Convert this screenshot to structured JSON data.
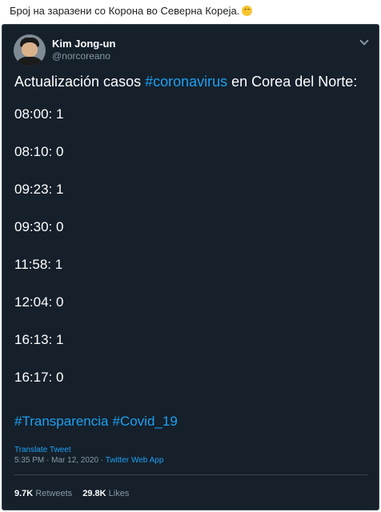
{
  "post": {
    "caption": "Број на заразени со Корона во Северна Кореја."
  },
  "tweet": {
    "user_name": "Kim Jong-un",
    "handle": "@norcoreano",
    "intro_before": "Actualización casos ",
    "intro_hashtag": "#coronavirus",
    "intro_after": " en Corea del Norte:",
    "entries": [
      "08:00: 1",
      "08:10: 0",
      "09:23: 1",
      "09:30: 0",
      "11:58: 1",
      "12:04: 0",
      "16:13: 1",
      "16:17: 0"
    ],
    "hashtags": [
      "#Transparencia",
      "#Covid_19"
    ],
    "translate_label": "Translate Tweet",
    "timestamp": "5:35 PM · Mar 12, 2020 · ",
    "source": "Twitter Web App",
    "retweets_count": "9.7K",
    "retweets_label": "Retweets",
    "likes_count": "29.8K",
    "likes_label": "Likes"
  },
  "icons": {
    "caption_emoji": "smiling-face-icon",
    "menu": "chevron-down-icon"
  },
  "colors": {
    "card_background": "#15202b",
    "link_blue": "#1da1f2",
    "secondary_text": "#8899a6"
  }
}
